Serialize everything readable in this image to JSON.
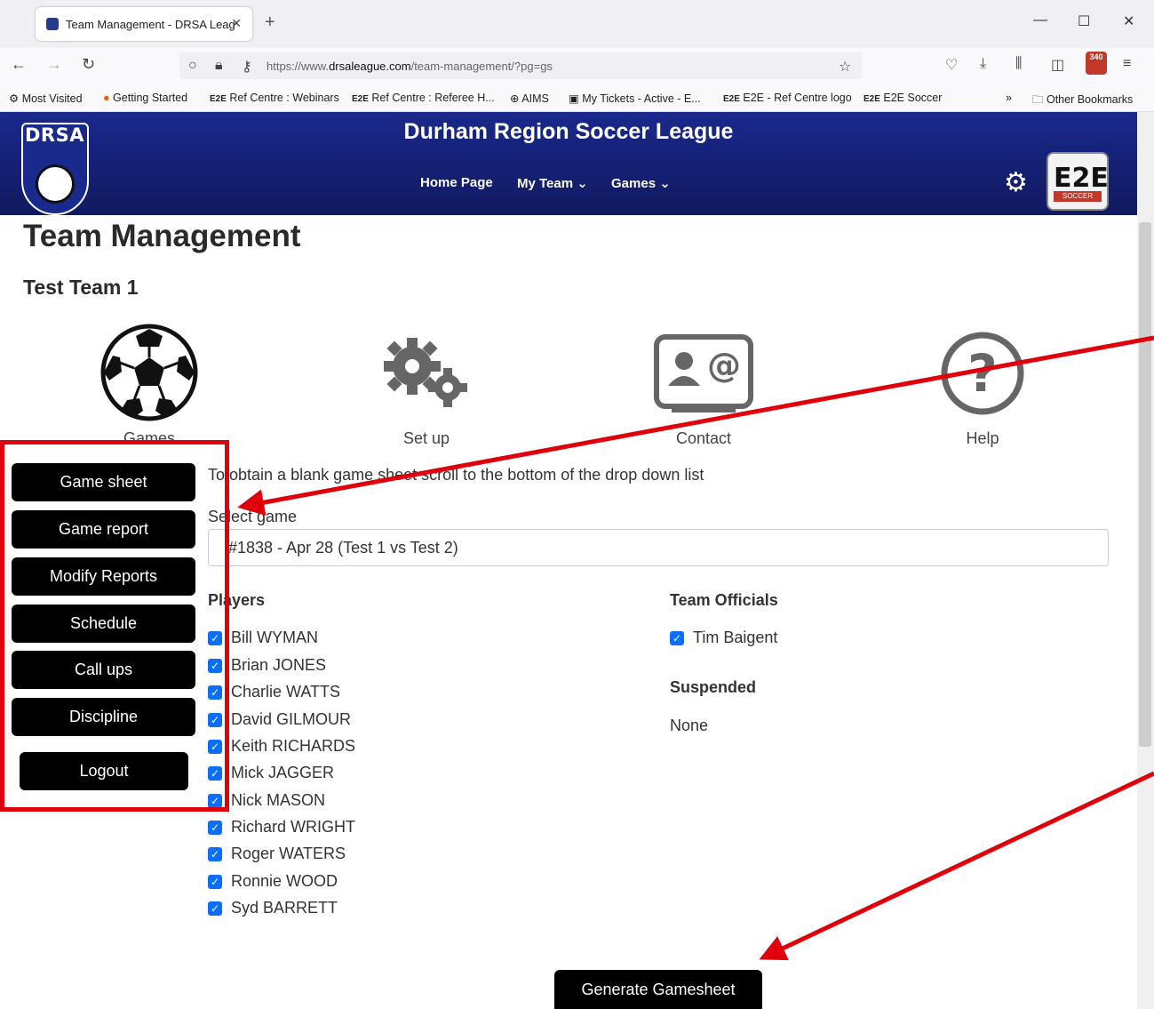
{
  "browser": {
    "tab_title": "Team Management - DRSA Leag",
    "tab_close": "✕",
    "new_tab": "+",
    "url_scheme": "https://www.",
    "url_domain": "drsaleague.com",
    "url_path": "/team-management/?pg=gs",
    "notification_count": "340",
    "bookmarks": [
      "Most Visited",
      "Getting Started",
      "Ref Centre : Webinars",
      "Ref Centre : Referee H...",
      "AIMS",
      "My Tickets - Active - E...",
      "E2E - Ref Centre logo",
      "E2E Soccer"
    ],
    "other_bookmarks": "Other Bookmarks",
    "bookmark_overflow": "»"
  },
  "header": {
    "logo_text": "DRSA",
    "site_title": "Durham Region Soccer League",
    "menu": {
      "home": "Home Page",
      "my_team": "My Team ⌄",
      "games": "Games ⌄"
    },
    "e2e_logo_text": "E2E",
    "e2e_logo_sub": "SOCCER"
  },
  "page": {
    "title": "Team Management",
    "team_name": "Test Team 1"
  },
  "features": {
    "games": "Games",
    "setup": "Set up",
    "contact": "Contact",
    "help": "Help"
  },
  "sidebar": {
    "game_sheet": "Game sheet",
    "game_report": "Game report",
    "modify_reports": "Modify Reports",
    "schedule": "Schedule",
    "call_ups": "Call ups",
    "discipline": "Discipline",
    "logout": "Logout"
  },
  "gamesheet": {
    "hint": "To obtain a blank game sheet scroll to the bottom of the drop down list",
    "select_label": "Select game",
    "selected_game": "#1838 - Apr 28 (Test 1 vs Test 2)",
    "players_heading": "Players",
    "players": [
      "Bill WYMAN",
      "Brian JONES",
      "Charlie WATTS",
      "David GILMOUR",
      "Keith RICHARDS",
      "Mick JAGGER",
      "Nick MASON",
      "Richard WRIGHT",
      "Roger WATERS",
      "Ronnie WOOD",
      "Syd BARRETT"
    ],
    "officials_heading": "Team Officials",
    "officials": [
      "Tim Baigent"
    ],
    "suspended_heading": "Suspended",
    "suspended_value": "None",
    "generate_button": "Generate Gamesheet"
  },
  "colors": {
    "header_blue": "#16227a",
    "checkbox_blue": "#0d6efd",
    "annotation_red": "#e0000b"
  }
}
